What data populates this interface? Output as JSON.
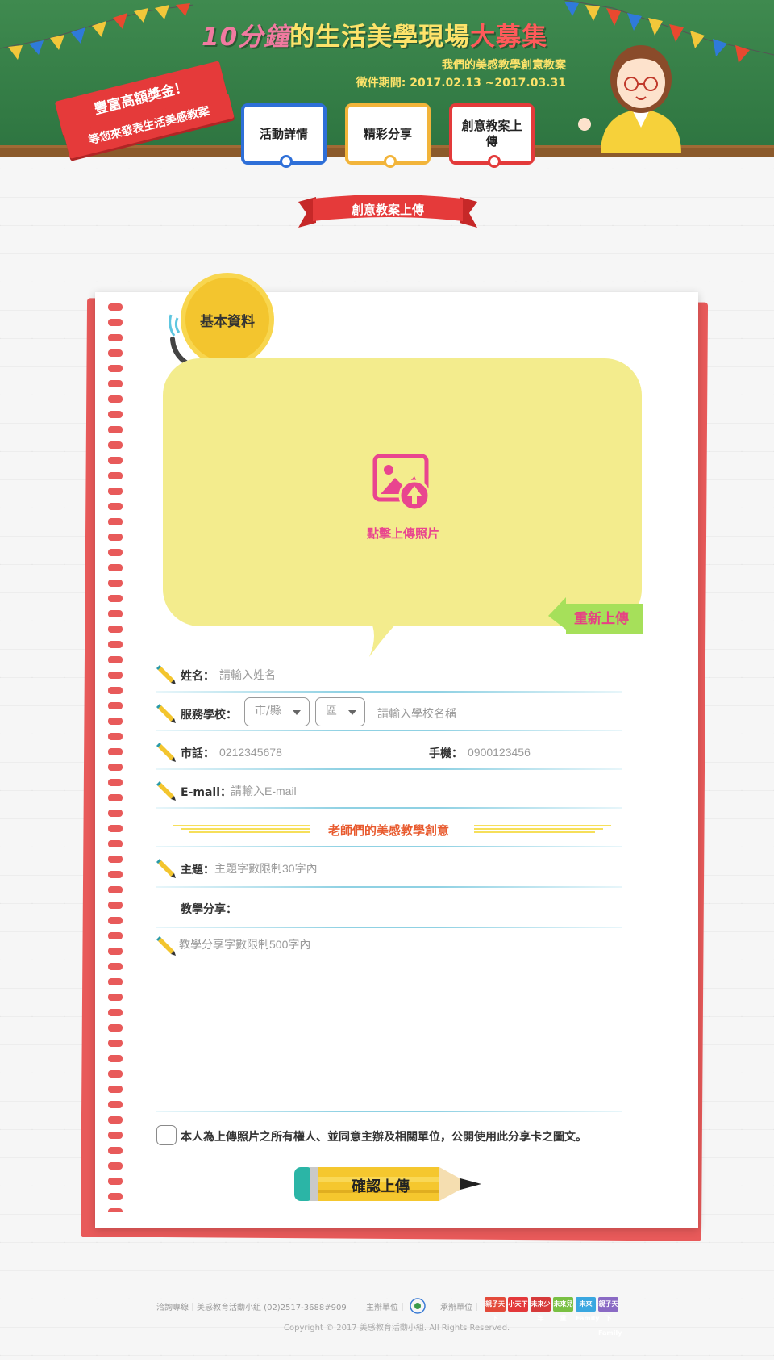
{
  "header": {
    "title_part1": "10分鐘",
    "title_part2": "的生活美學現場",
    "title_part3": "大募集",
    "subtitle": "我們的美感教學創意教案",
    "period": "徵件期間: 2017.02.13 ~2017.03.31",
    "ribbon_line1": "豐富高額獎金！",
    "ribbon_line2": "等您來發表生活美感教案"
  },
  "nav": {
    "item1": "活動詳情",
    "item2": "精彩分享",
    "item3": "創意教案上傳"
  },
  "section": {
    "ribbon_label": "創意教案上傳",
    "badge_label": "基本資料"
  },
  "photo": {
    "upload_label": "點擊上傳照片",
    "reupload_label": "重新上傳"
  },
  "form": {
    "name_label": "姓名：",
    "name_placeholder": "請輸入姓名",
    "school_label": "服務學校：",
    "city_select": "市/縣",
    "district_select": "區",
    "school_placeholder": "請輸入學校名稱",
    "phone_label": "市話：",
    "phone_placeholder": "0212345678",
    "mobile_label": "手機：",
    "mobile_placeholder": "0900123456",
    "email_label": "E-mail：",
    "email_placeholder": "請輸入E-mail",
    "divider_title": "老師們的美感教學創意",
    "topic_label": "主題：",
    "topic_placeholder": "主題字數限制30字內",
    "share_label": "教學分享：",
    "share_placeholder": "教學分享字數限制500字內",
    "agree_text": "本人為上傳照片之所有權人、並同意主辦及相關單位，公開使用此分享卡之圖文。",
    "submit_label": "確認上傳"
  },
  "footer": {
    "contact": "洽詢專線｜美感教育活動小組 (02)2517-3688#909",
    "host": "主辦單位｜",
    "organizer": "承辦單位｜",
    "copyright": "Copyright © 2017 美感教育活動小組. All Rights Reserved.",
    "logos": [
      "親子天下",
      "小天下",
      "未來少年",
      "未來兒童",
      "未來Family",
      "親子天下Family"
    ]
  },
  "colors": {
    "board_green": "#2d7440",
    "accent_red": "#e53a3a",
    "accent_yellow": "#f3c52e",
    "photo_bg": "#f3ec8d",
    "upload_pink": "#e9458f"
  }
}
